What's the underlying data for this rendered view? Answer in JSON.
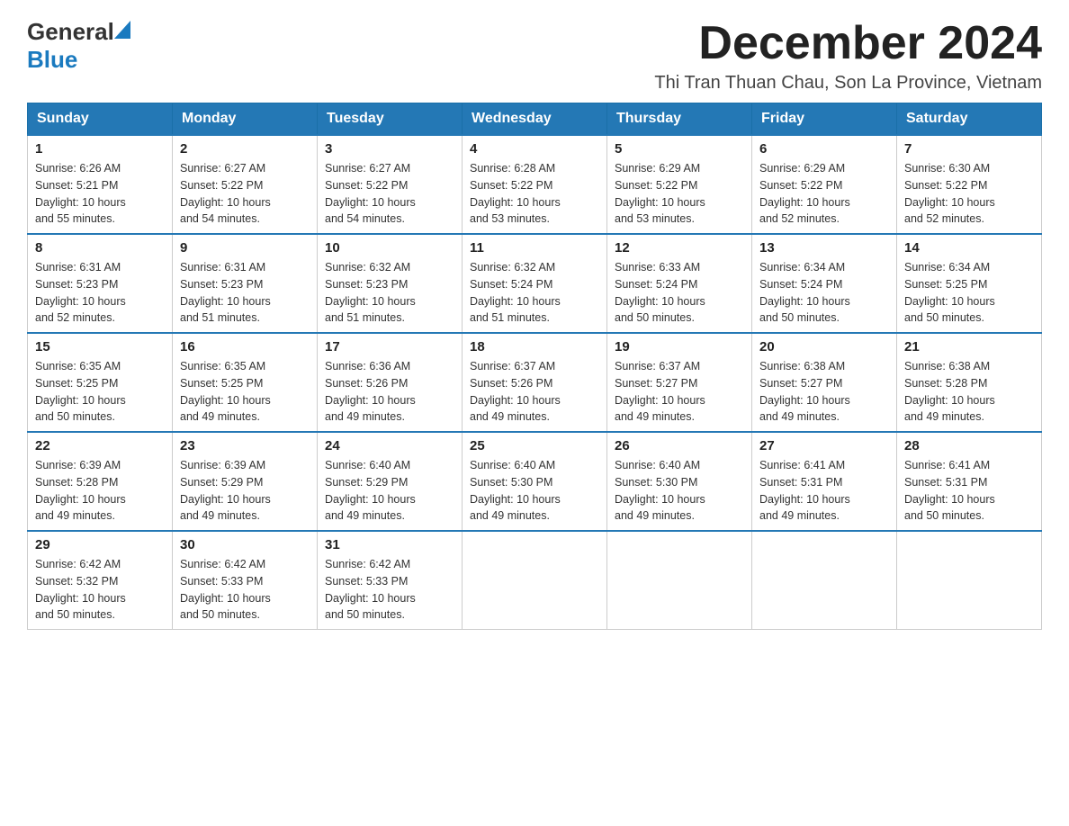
{
  "header": {
    "logo_general": "General",
    "logo_blue": "Blue",
    "month_title": "December 2024",
    "location": "Thi Tran Thuan Chau, Son La Province, Vietnam"
  },
  "days_of_week": [
    "Sunday",
    "Monday",
    "Tuesday",
    "Wednesday",
    "Thursday",
    "Friday",
    "Saturday"
  ],
  "weeks": [
    [
      {
        "day": "1",
        "sunrise": "6:26 AM",
        "sunset": "5:21 PM",
        "daylight": "10 hours and 55 minutes."
      },
      {
        "day": "2",
        "sunrise": "6:27 AM",
        "sunset": "5:22 PM",
        "daylight": "10 hours and 54 minutes."
      },
      {
        "day": "3",
        "sunrise": "6:27 AM",
        "sunset": "5:22 PM",
        "daylight": "10 hours and 54 minutes."
      },
      {
        "day": "4",
        "sunrise": "6:28 AM",
        "sunset": "5:22 PM",
        "daylight": "10 hours and 53 minutes."
      },
      {
        "day": "5",
        "sunrise": "6:29 AM",
        "sunset": "5:22 PM",
        "daylight": "10 hours and 53 minutes."
      },
      {
        "day": "6",
        "sunrise": "6:29 AM",
        "sunset": "5:22 PM",
        "daylight": "10 hours and 52 minutes."
      },
      {
        "day": "7",
        "sunrise": "6:30 AM",
        "sunset": "5:22 PM",
        "daylight": "10 hours and 52 minutes."
      }
    ],
    [
      {
        "day": "8",
        "sunrise": "6:31 AM",
        "sunset": "5:23 PM",
        "daylight": "10 hours and 52 minutes."
      },
      {
        "day": "9",
        "sunrise": "6:31 AM",
        "sunset": "5:23 PM",
        "daylight": "10 hours and 51 minutes."
      },
      {
        "day": "10",
        "sunrise": "6:32 AM",
        "sunset": "5:23 PM",
        "daylight": "10 hours and 51 minutes."
      },
      {
        "day": "11",
        "sunrise": "6:32 AM",
        "sunset": "5:24 PM",
        "daylight": "10 hours and 51 minutes."
      },
      {
        "day": "12",
        "sunrise": "6:33 AM",
        "sunset": "5:24 PM",
        "daylight": "10 hours and 50 minutes."
      },
      {
        "day": "13",
        "sunrise": "6:34 AM",
        "sunset": "5:24 PM",
        "daylight": "10 hours and 50 minutes."
      },
      {
        "day": "14",
        "sunrise": "6:34 AM",
        "sunset": "5:25 PM",
        "daylight": "10 hours and 50 minutes."
      }
    ],
    [
      {
        "day": "15",
        "sunrise": "6:35 AM",
        "sunset": "5:25 PM",
        "daylight": "10 hours and 50 minutes."
      },
      {
        "day": "16",
        "sunrise": "6:35 AM",
        "sunset": "5:25 PM",
        "daylight": "10 hours and 49 minutes."
      },
      {
        "day": "17",
        "sunrise": "6:36 AM",
        "sunset": "5:26 PM",
        "daylight": "10 hours and 49 minutes."
      },
      {
        "day": "18",
        "sunrise": "6:37 AM",
        "sunset": "5:26 PM",
        "daylight": "10 hours and 49 minutes."
      },
      {
        "day": "19",
        "sunrise": "6:37 AM",
        "sunset": "5:27 PM",
        "daylight": "10 hours and 49 minutes."
      },
      {
        "day": "20",
        "sunrise": "6:38 AM",
        "sunset": "5:27 PM",
        "daylight": "10 hours and 49 minutes."
      },
      {
        "day": "21",
        "sunrise": "6:38 AM",
        "sunset": "5:28 PM",
        "daylight": "10 hours and 49 minutes."
      }
    ],
    [
      {
        "day": "22",
        "sunrise": "6:39 AM",
        "sunset": "5:28 PM",
        "daylight": "10 hours and 49 minutes."
      },
      {
        "day": "23",
        "sunrise": "6:39 AM",
        "sunset": "5:29 PM",
        "daylight": "10 hours and 49 minutes."
      },
      {
        "day": "24",
        "sunrise": "6:40 AM",
        "sunset": "5:29 PM",
        "daylight": "10 hours and 49 minutes."
      },
      {
        "day": "25",
        "sunrise": "6:40 AM",
        "sunset": "5:30 PM",
        "daylight": "10 hours and 49 minutes."
      },
      {
        "day": "26",
        "sunrise": "6:40 AM",
        "sunset": "5:30 PM",
        "daylight": "10 hours and 49 minutes."
      },
      {
        "day": "27",
        "sunrise": "6:41 AM",
        "sunset": "5:31 PM",
        "daylight": "10 hours and 49 minutes."
      },
      {
        "day": "28",
        "sunrise": "6:41 AM",
        "sunset": "5:31 PM",
        "daylight": "10 hours and 50 minutes."
      }
    ],
    [
      {
        "day": "29",
        "sunrise": "6:42 AM",
        "sunset": "5:32 PM",
        "daylight": "10 hours and 50 minutes."
      },
      {
        "day": "30",
        "sunrise": "6:42 AM",
        "sunset": "5:33 PM",
        "daylight": "10 hours and 50 minutes."
      },
      {
        "day": "31",
        "sunrise": "6:42 AM",
        "sunset": "5:33 PM",
        "daylight": "10 hours and 50 minutes."
      },
      null,
      null,
      null,
      null
    ]
  ],
  "labels": {
    "sunrise": "Sunrise:",
    "sunset": "Sunset:",
    "daylight": "Daylight:"
  }
}
